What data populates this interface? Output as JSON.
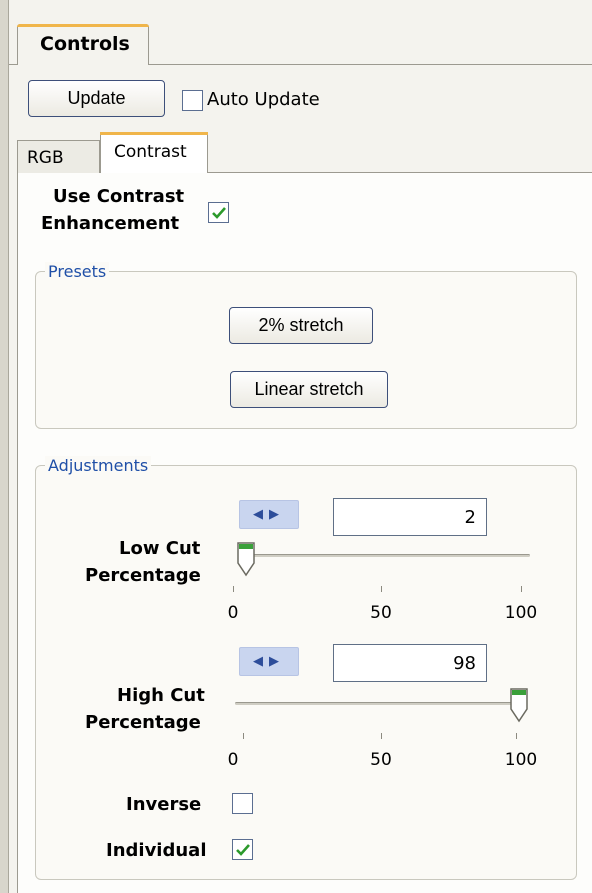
{
  "panel": {
    "tab_label": "Controls"
  },
  "toolbar": {
    "update_label": "Update",
    "auto_update_label": "Auto Update",
    "auto_update_checked": false
  },
  "tabs": [
    {
      "label": "RGB",
      "active": false
    },
    {
      "label": "Contrast",
      "active": true
    }
  ],
  "contrast": {
    "use_label_line1": "Use Contrast",
    "use_label_line2": "Enhancement",
    "use_checked": true,
    "presets": {
      "legend": "Presets",
      "buttons": [
        "2% stretch",
        "Linear stretch"
      ]
    },
    "adjustments": {
      "legend": "Adjustments",
      "spin_icon": "left-right-arrows-icon",
      "low_cut": {
        "label_line1": "Low Cut",
        "label_line2": "Percentage",
        "value": "2",
        "slider_value": 2,
        "min": 0,
        "max": 100
      },
      "high_cut": {
        "label_line1": "High Cut",
        "label_line2": "Percentage",
        "value": "98",
        "slider_value": 98,
        "min": 0,
        "max": 100
      },
      "tick_labels": [
        "0",
        "50",
        "100"
      ],
      "inverse": {
        "label": "Inverse",
        "checked": false
      },
      "individual": {
        "label": "Individual",
        "checked": true
      }
    }
  },
  "colors": {
    "accent_tab": "#f0b54a",
    "legend_text": "#1f4fa7",
    "check_green": "#2c9a2c",
    "thumb_green": "#3aa03a"
  }
}
